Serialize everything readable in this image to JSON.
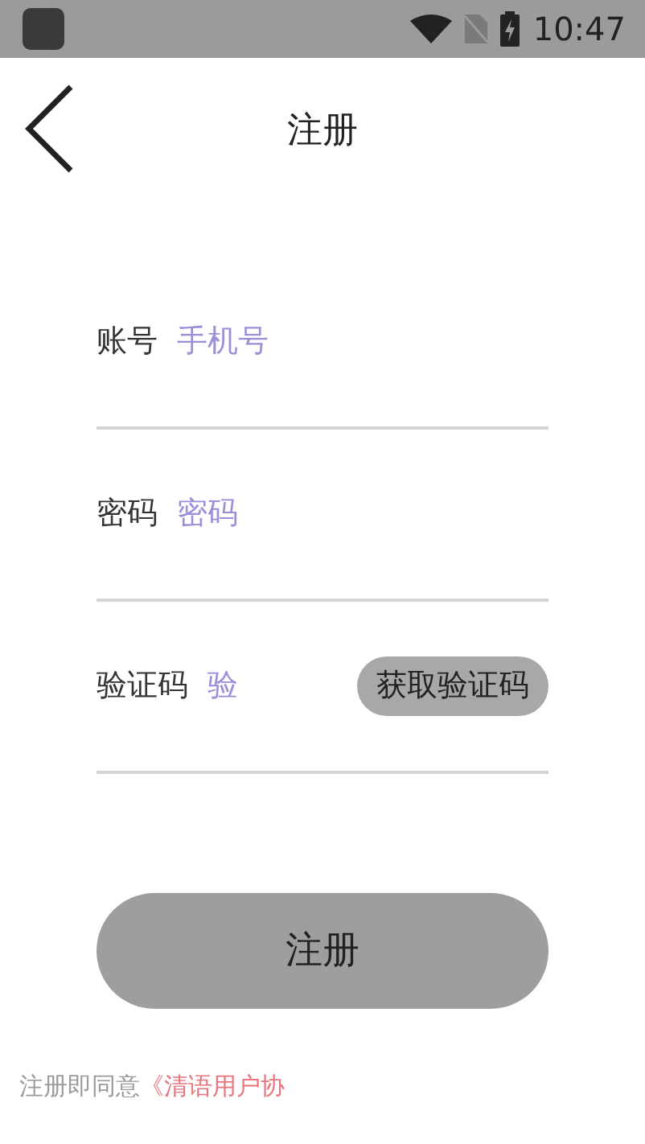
{
  "status_bar": {
    "time": "10:47"
  },
  "header": {
    "title": "注册"
  },
  "fields": [
    {
      "label": "账号",
      "placeholder": "手机号",
      "kind": "text"
    },
    {
      "label": "密码",
      "placeholder": "密码",
      "kind": "password"
    },
    {
      "label": "验证码",
      "placeholder": "验",
      "kind": "code",
      "action": "获取验证码"
    }
  ],
  "submit": "注册",
  "agreement": {
    "prefix": "注册即同意",
    "link": "《清语用户协"
  }
}
